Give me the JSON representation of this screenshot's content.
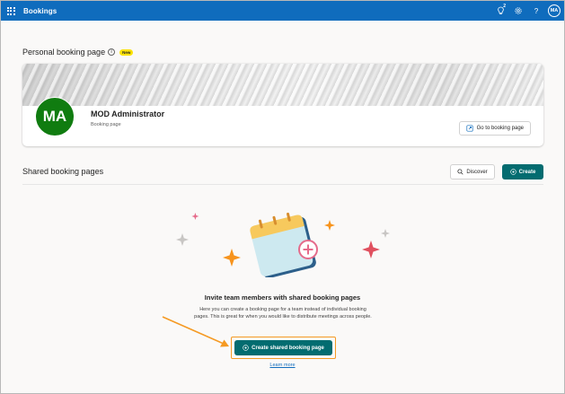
{
  "app": {
    "title": "Bookings"
  },
  "header": {
    "notification_count": "2",
    "icons": [
      "waffle-icon",
      "lightbulb-icon",
      "gear-icon",
      "help-icon"
    ],
    "help_label": "?",
    "avatar_initials": "MA"
  },
  "personal": {
    "section_title": "Personal booking page",
    "info_label": "i",
    "new_badge": "New",
    "avatar_initials": "MA",
    "name": "MOD Administrator",
    "subtitle": "Booking page",
    "goto_label": "Go to booking page"
  },
  "shared": {
    "section_title": "Shared booking pages",
    "discover_label": "Discover",
    "create_label": "Create"
  },
  "empty_state": {
    "title": "Invite team members with shared booking pages",
    "description": "Here you can create a booking page for a team instead of individual booking pages. This is great for when you would like to distribute meetings across people.",
    "create_shared_label": "Create shared booking page",
    "learn_more_label": "Learn more"
  },
  "colors": {
    "topbar": "#0f6cbd",
    "primary_button": "#036c70",
    "avatar_green": "#107c10",
    "highlight": "#f59a23",
    "new_badge": "#fde300"
  }
}
